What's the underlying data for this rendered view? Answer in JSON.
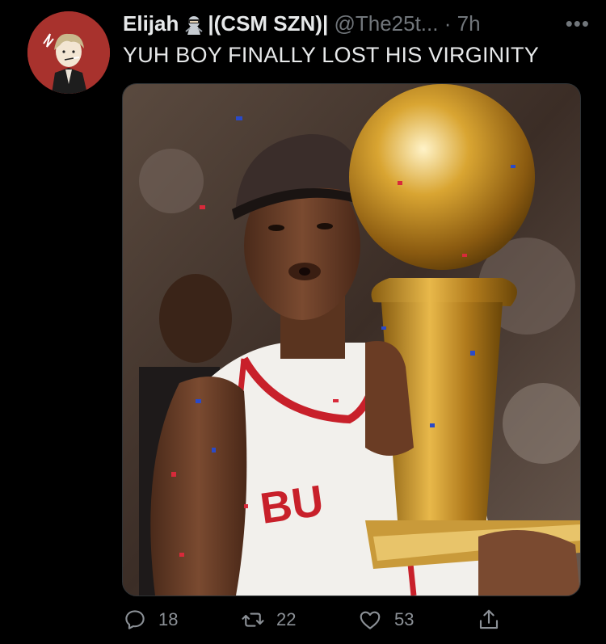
{
  "tweet": {
    "author_name": "Elijah",
    "display_suffix": "|(CSM SZN)|",
    "handle": "@The25t...",
    "separator": "·",
    "time": "7h",
    "text": "YUH BOY FINALLY LOST HIS VIRGINITY"
  },
  "actions": {
    "replies": "18",
    "retweets": "22",
    "likes": "53"
  },
  "icons": [
    "avatar-image",
    "ninja-emoji-icon",
    "more-options-icon",
    "reply-icon",
    "retweet-icon",
    "like-icon",
    "share-icon"
  ],
  "colors": {
    "background": "#000000",
    "primary_text": "#e7e9ea",
    "secondary_text": "#71767b",
    "avatar_bg": "#a8322d"
  }
}
